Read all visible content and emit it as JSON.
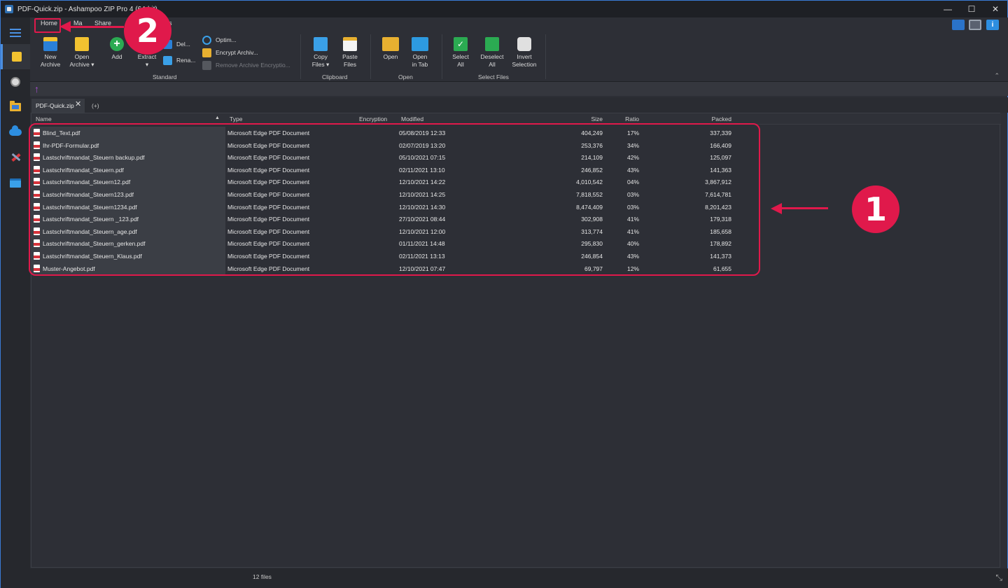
{
  "window": {
    "title": "PDF-Quick.zip - Ashampoo ZIP Pro 4 (64-bit)"
  },
  "window_controls": {
    "minimize": "—",
    "maximize": "☐",
    "close": "✕"
  },
  "ribbon_tabs": [
    "Home",
    "Ma",
    "Share",
    "s"
  ],
  "ribbon": {
    "new_archive": "New\nArchive",
    "open_archive": "Open\nArchive ▾",
    "add": "Add",
    "extract": "Extract\n▾",
    "delete": "Del...",
    "rename": "Rena...",
    "optimize": "Optim...",
    "encrypt": "Encrypt Archiv...",
    "remove_encryption": "Remove Archive Encryptio...",
    "copy_files": "Copy\nFiles ▾",
    "paste_files": "Paste\nFiles",
    "open": "Open",
    "open_in_tab": "Open\nin Tab",
    "select_all": "Select\nAll",
    "deselect_all": "Deselect\nAll",
    "invert_selection": "Invert\nSelection",
    "groups": {
      "standard": "Standard",
      "clipboard": "Clipboard",
      "open": "Open",
      "select_files": "Select Files"
    }
  },
  "doc_tabs": {
    "active": "PDF-Quick.zip",
    "close": "✕",
    "add": "(+)"
  },
  "columns": {
    "name": "Name",
    "type": "Type",
    "encryption": "Encryption",
    "modified": "Modified",
    "size": "Size",
    "ratio": "Ratio",
    "packed": "Packed"
  },
  "files": [
    {
      "name": "Blind_Text.pdf",
      "type": "Microsoft Edge PDF Document",
      "modified": "05/08/2019 12:33",
      "size": "404,249",
      "ratio": "17%",
      "packed": "337,339"
    },
    {
      "name": "Ihr-PDF-Formular.pdf",
      "type": "Microsoft Edge PDF Document",
      "modified": "02/07/2019 13:20",
      "size": "253,376",
      "ratio": "34%",
      "packed": "166,409"
    },
    {
      "name": "Lastschriftmandat_Steuern backup.pdf",
      "type": "Microsoft Edge PDF Document",
      "modified": "05/10/2021 07:15",
      "size": "214,109",
      "ratio": "42%",
      "packed": "125,097"
    },
    {
      "name": "Lastschriftmandat_Steuern.pdf",
      "type": "Microsoft Edge PDF Document",
      "modified": "02/11/2021 13:10",
      "size": "246,852",
      "ratio": "43%",
      "packed": "141,363"
    },
    {
      "name": "Lastschriftmandat_Steuern12.pdf",
      "type": "Microsoft Edge PDF Document",
      "modified": "12/10/2021 14:22",
      "size": "4,010,542",
      "ratio": "04%",
      "packed": "3,867,912"
    },
    {
      "name": "Lastschriftmandat_Steuern123.pdf",
      "type": "Microsoft Edge PDF Document",
      "modified": "12/10/2021 14:25",
      "size": "7,818,552",
      "ratio": "03%",
      "packed": "7,614,781"
    },
    {
      "name": "Lastschriftmandat_Steuern1234.pdf",
      "type": "Microsoft Edge PDF Document",
      "modified": "12/10/2021 14:30",
      "size": "8,474,409",
      "ratio": "03%",
      "packed": "8,201,423"
    },
    {
      "name": "Lastschriftmandat_Steuern _123.pdf",
      "type": "Microsoft Edge PDF Document",
      "modified": "27/10/2021 08:44",
      "size": "302,908",
      "ratio": "41%",
      "packed": "179,318"
    },
    {
      "name": "Lastschriftmandat_Steuern_age.pdf",
      "type": "Microsoft Edge PDF Document",
      "modified": "12/10/2021 12:00",
      "size": "313,774",
      "ratio": "41%",
      "packed": "185,658"
    },
    {
      "name": "Lastschriftmandat_Steuern_gerken.pdf",
      "type": "Microsoft Edge PDF Document",
      "modified": "01/11/2021 14:48",
      "size": "295,830",
      "ratio": "40%",
      "packed": "178,892"
    },
    {
      "name": "Lastschriftmandat_Steuern_Klaus.pdf",
      "type": "Microsoft Edge PDF Document",
      "modified": "02/11/2021 13:13",
      "size": "246,854",
      "ratio": "43%",
      "packed": "141,373"
    },
    {
      "name": "Muster-Angebot.pdf",
      "type": "Microsoft Edge PDF Document",
      "modified": "12/10/2021 07:47",
      "size": "69,797",
      "ratio": "12%",
      "packed": "61,655"
    }
  ],
  "status": {
    "count": "12 files"
  },
  "annotations": {
    "one": "1",
    "two": "2"
  },
  "colors": {
    "accent": "#3a7bd5",
    "annotation": "#e0194b",
    "background": "#2d2f36"
  }
}
